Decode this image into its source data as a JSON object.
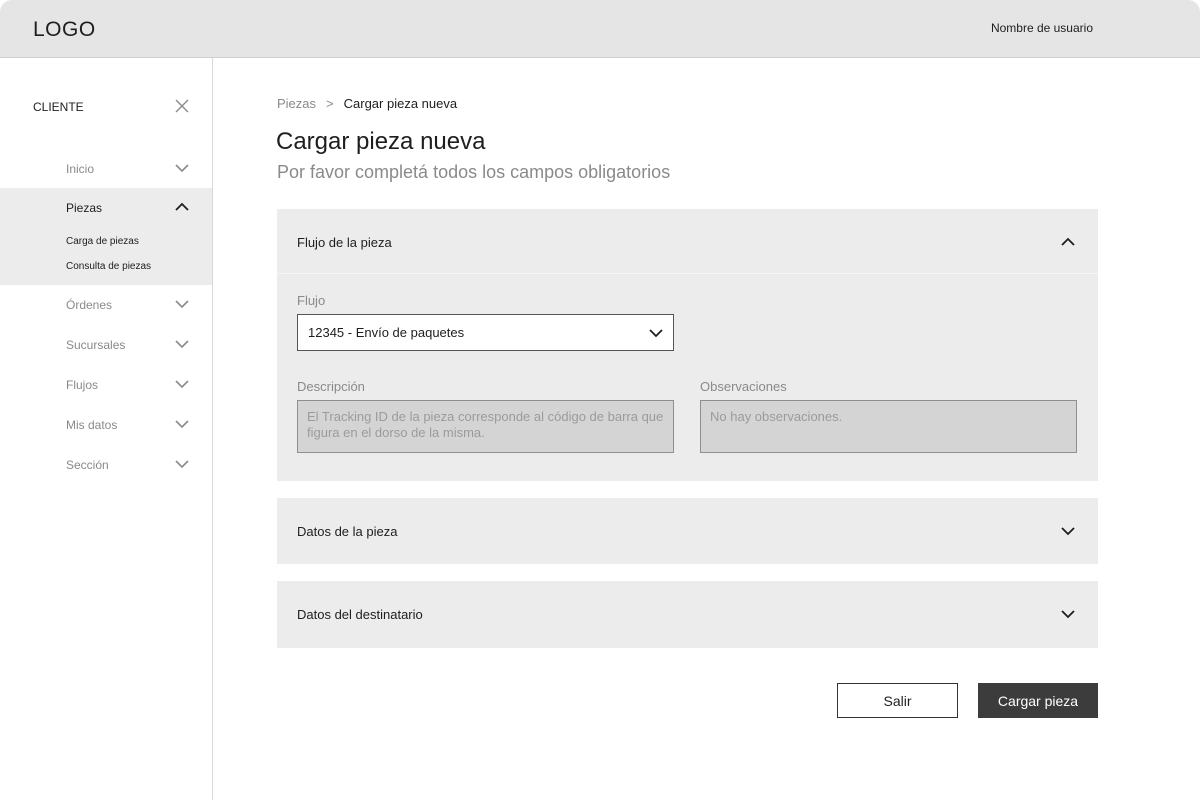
{
  "header": {
    "logo": "LOGO",
    "username": "Nombre de usuario"
  },
  "sidebar": {
    "title": "CLIENTE",
    "close_icon": "close-icon",
    "items": [
      {
        "label": "Inicio",
        "expanded": false
      },
      {
        "label": "Piezas",
        "expanded": true,
        "children": [
          "Carga de piezas",
          "Consulta de piezas"
        ]
      },
      {
        "label": "Órdenes",
        "expanded": false
      },
      {
        "label": "Sucursales",
        "expanded": false
      },
      {
        "label": "Flujos",
        "expanded": false
      },
      {
        "label": "Mis datos",
        "expanded": false
      },
      {
        "label": "Sección",
        "expanded": false
      }
    ]
  },
  "breadcrumb": {
    "parent": "Piezas",
    "separator": ">",
    "current": "Cargar pieza nueva"
  },
  "page": {
    "title": "Cargar pieza nueva",
    "subtitle": "Por favor completá todos los campos obligatorios"
  },
  "panels": {
    "flujo": {
      "title": "Flujo de la pieza",
      "expanded": true,
      "flujo_label": "Flujo",
      "flujo_value": "12345 - Envío de paquetes",
      "descripcion_label": "Descripción",
      "descripcion_placeholder": "El Tracking ID de la pieza corresponde al código de barra que figura en el dorso de la misma.",
      "observaciones_label": "Observaciones",
      "observaciones_placeholder": "No hay observaciones."
    },
    "datos_pieza": {
      "title": "Datos de la pieza",
      "expanded": false
    },
    "datos_destinatario": {
      "title": "Datos del destinatario",
      "expanded": false
    }
  },
  "actions": {
    "exit_label": "Salir",
    "submit_label": "Cargar pieza"
  },
  "colors": {
    "header_bg": "#e5e5e5",
    "panel_bg": "#ececec",
    "primary_button": "#3c3c3c"
  }
}
